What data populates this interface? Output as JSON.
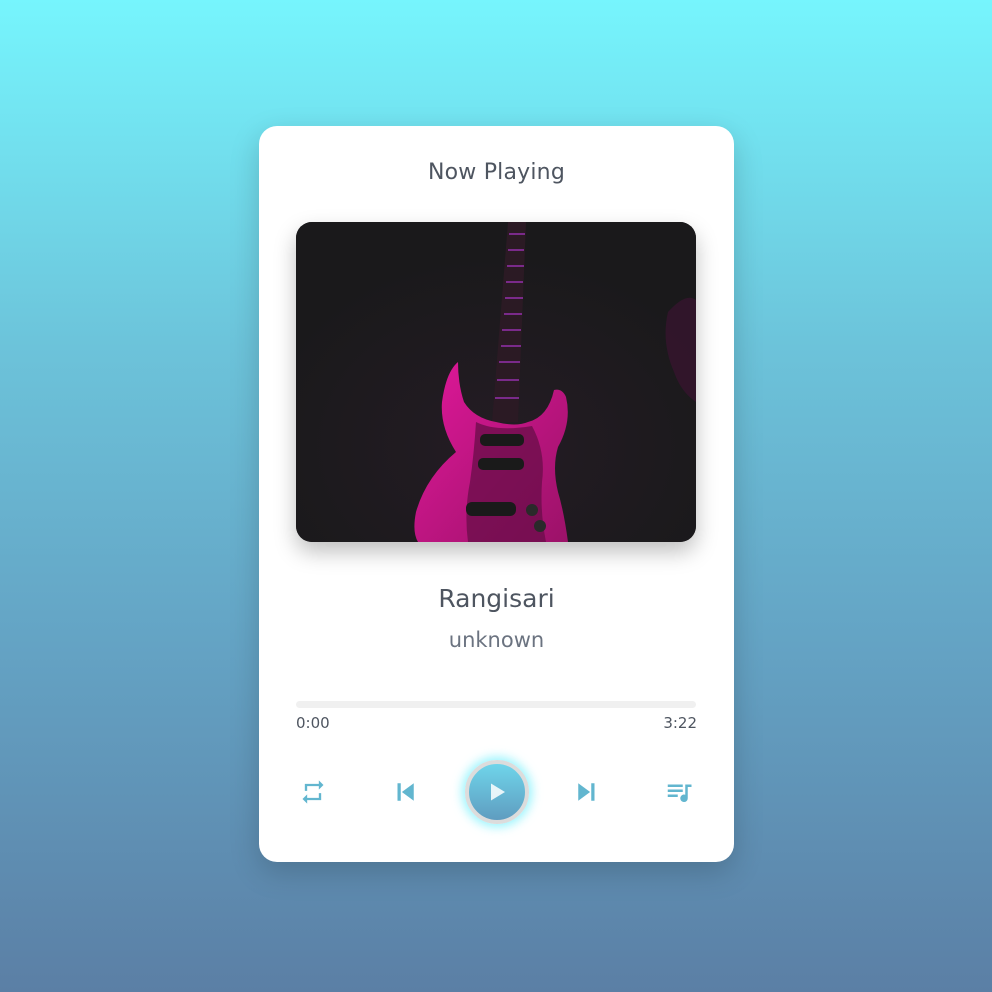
{
  "header": {
    "title": "Now Playing"
  },
  "album_art": {
    "alt": "Pink electric guitar on dark background"
  },
  "track": {
    "title": "Rangisari",
    "artist": "unknown"
  },
  "progress": {
    "current_time": "0:00",
    "total_time": "3:22",
    "fraction": 0
  },
  "controls": {
    "repeat_icon": "repeat-icon",
    "prev_icon": "skip-previous-icon",
    "play_icon": "play-icon",
    "next_icon": "skip-next-icon",
    "playlist_icon": "playlist-icon"
  },
  "colors": {
    "accent_light": "#6fd5ea",
    "accent_dark": "#5f9dc0",
    "glow": "#76f0fc",
    "text": "#4e5560"
  }
}
